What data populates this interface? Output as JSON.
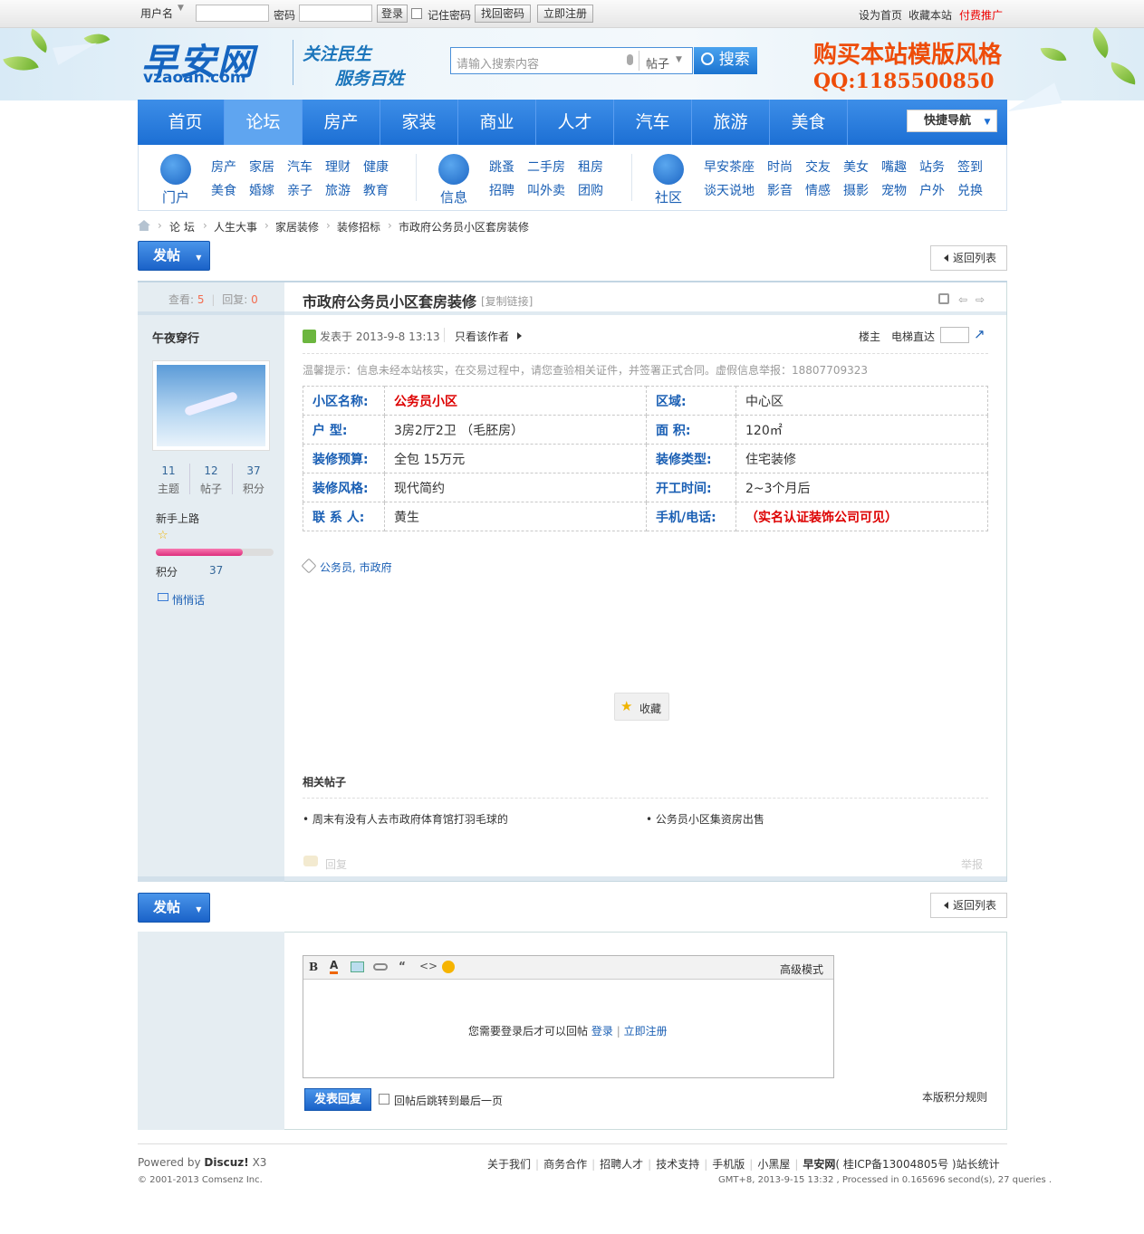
{
  "topbar": {
    "username_label": "用户名",
    "password_label": "密码",
    "login_button": "登录",
    "remember_label": "记住密码",
    "recover_button": "找回密码",
    "register_button": "立即注册",
    "set_home": "设为首页",
    "bookmark": "收藏本站",
    "paid_promo": "付费推广"
  },
  "header": {
    "logo_cn": "早安网",
    "logo_en": "vzaoan.com",
    "slogan1": "关注民生",
    "slogan2": "服务百姓",
    "search_placeholder": "请输入搜索内容",
    "search_type": "帖子",
    "search_button": "搜索",
    "ad_line1": "购买本站模版风格",
    "ad_line2": "QQ:1185500850"
  },
  "nav": {
    "items": [
      "首页",
      "论坛",
      "房产",
      "家装",
      "商业",
      "人才",
      "汽车",
      "旅游",
      "美食"
    ],
    "quick_nav": "快捷导航"
  },
  "subnav": {
    "groups": [
      {
        "label": "门户",
        "links": [
          "房产",
          "家居",
          "汽车",
          "理财",
          "健康",
          "美食",
          "婚嫁",
          "亲子",
          "旅游",
          "教育"
        ]
      },
      {
        "label": "信息",
        "links": [
          "跳蚤",
          "二手房",
          "租房",
          "招聘",
          "叫外卖",
          "团购"
        ]
      },
      {
        "label": "社区",
        "links": [
          "早安茶座",
          "时尚",
          "交友",
          "美女",
          "嘴趣",
          "站务",
          "签到",
          "谈天说地",
          "影音",
          "情感",
          "摄影",
          "宠物",
          "户外",
          "兑换"
        ]
      }
    ]
  },
  "breadcrumb": [
    "论 坛",
    "人生大事",
    "家居装修",
    "装修招标",
    "市政府公务员小区套房装修"
  ],
  "buttons": {
    "post": "发帖",
    "back": "返回列表"
  },
  "thread": {
    "views_label": "查看:",
    "views": "5",
    "replies_label": "回复:",
    "replies": "0",
    "title": "市政府公务员小区套房装修",
    "copy_link": "[复制链接]",
    "author": "午夜穿行",
    "stats": [
      {
        "value": "11",
        "label": "主题"
      },
      {
        "value": "12",
        "label": "帖子"
      },
      {
        "value": "37",
        "label": "积分"
      }
    ],
    "rank": "新手上路",
    "points_label": "积分",
    "points": "37",
    "pm": "悄悄话",
    "posted_at": "发表于 2013-9-8 13:13",
    "only_author": "只看该作者",
    "floor": "楼主",
    "elevator": "电梯直达",
    "notice": "温馨提示：信息未经本站核实，在交易过程中，请您查验相关证件，并签署正式合同。虚假信息举报：18807709323",
    "info_rows": [
      [
        "小区名称:",
        "公务员小区",
        "区域:",
        "中心区"
      ],
      [
        "户 型:",
        "3房2厅2卫 （毛胚房）",
        "面 积:",
        "120㎡"
      ],
      [
        "装修预算:",
        "全包 15万元",
        "装修类型:",
        "住宅装修"
      ],
      [
        "装修风格:",
        "现代简约",
        "开工时间:",
        "2~3个月后"
      ],
      [
        "联 系 人:",
        "黄生",
        "手机/电话:",
        "（实名认证装饰公司可见）"
      ]
    ],
    "tags": "公务员, 市政府",
    "favorite": "收藏",
    "related_title": "相关帖子",
    "related": [
      "周末有没有人去市政府体育馆打羽毛球的",
      "公务员小区集资房出售"
    ],
    "reply": "回复",
    "report": "举报"
  },
  "reply_box": {
    "advanced": "高级模式",
    "need_login": "您需要登录后才可以回帖",
    "login": "登录",
    "register": "立即注册",
    "submit": "发表回复",
    "jump_last": "回帖后跳转到最后一页",
    "rules": "本版积分规则"
  },
  "footer": {
    "powered": "Powered by",
    "discuz": "Discuz!",
    "version": "X3",
    "copyright": "© 2001-2013 Comsenz Inc.",
    "links": [
      "关于我们",
      "商务合作",
      "招聘人才",
      "技术支持",
      "手机版",
      "小黑屋"
    ],
    "site": "早安网",
    "icp": "( 桂ICP备13004805号 )",
    "stats": "站长统计",
    "time": "GMT+8, 2013-9-15 13:32 , Processed in 0.165696 second(s), 27 queries ."
  }
}
